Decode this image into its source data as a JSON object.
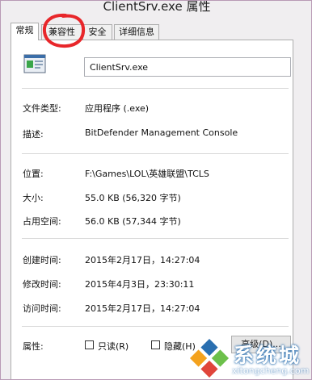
{
  "window": {
    "title": "ClientSrv.exe 属性"
  },
  "tabs": [
    {
      "label": "常规",
      "active": true
    },
    {
      "label": "兼容性",
      "active": false
    },
    {
      "label": "安全",
      "active": false
    },
    {
      "label": "详细信息",
      "active": false
    }
  ],
  "file": {
    "icon": "exe-file-icon",
    "name": "ClientSrv.exe"
  },
  "info": {
    "type_label": "文件类型:",
    "type_value": "应用程序 (.exe)",
    "desc_label": "描述:",
    "desc_value": "BitDefender Management Console",
    "location_label": "位置:",
    "location_value": "F:\\Games\\LOL\\英雄联盟\\TCLS",
    "size_label": "大小:",
    "size_value": "55.0 KB (56,320 字节)",
    "disk_label": "占用空间:",
    "disk_value": "56.0 KB (57,344 字节)",
    "created_label": "创建时间:",
    "created_value": "2015年2月17日，14:27:04",
    "modified_label": "修改时间:",
    "modified_value": "2015年4月3日，23:30:11",
    "accessed_label": "访问时间:",
    "accessed_value": "2015年2月17日，14:27:04"
  },
  "attributes": {
    "label": "属性:",
    "readonly_label": "只读(R)",
    "readonly_checked": false,
    "hidden_label": "隐藏(H)",
    "hidden_checked": false,
    "advanced_button": "高级(D)..."
  },
  "watermark": {
    "brand": "系统城",
    "url": "xitongcheng.com",
    "colors": [
      "#2a6fb0",
      "#6cc04a",
      "#f4a21d",
      "#e0453b"
    ]
  },
  "annotation_color": "#e8262a"
}
